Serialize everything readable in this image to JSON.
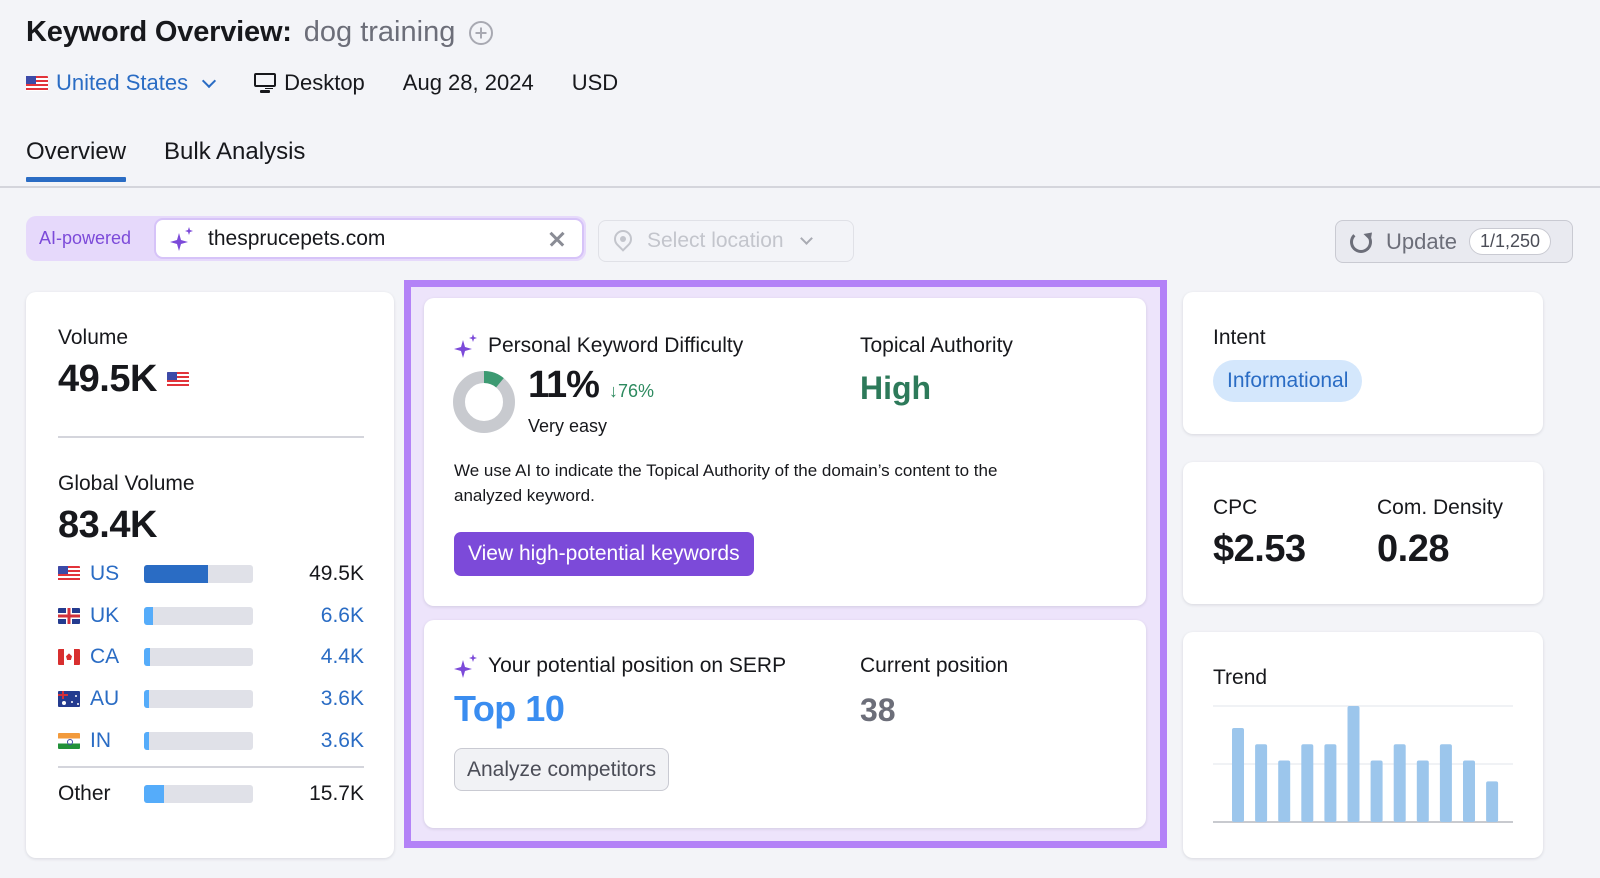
{
  "header": {
    "title": "Keyword Overview:",
    "keyword": "dog training",
    "add_icon": "plus-circle-icon",
    "database": "United States",
    "device": "Desktop",
    "date": "Aug 28, 2024",
    "currency": "USD"
  },
  "tabs": [
    {
      "label": "Overview",
      "active": true
    },
    {
      "label": "Bulk Analysis",
      "active": false
    }
  ],
  "domain_bar": {
    "ai_label": "AI-powered",
    "domain_value": "thesprucepets.com",
    "location_placeholder": "Select location",
    "update_label": "Update",
    "update_count": "1/1,250"
  },
  "volume": {
    "label": "Volume",
    "value": "49.5K",
    "global_label": "Global Volume",
    "global_value": "83.4K",
    "countries": [
      {
        "code": "US",
        "value": "49.5K",
        "share": 0.59,
        "flag": "us"
      },
      {
        "code": "UK",
        "value": "6.6K",
        "share": 0.079,
        "flag": "uk"
      },
      {
        "code": "CA",
        "value": "4.4K",
        "share": 0.053,
        "flag": "ca"
      },
      {
        "code": "AU",
        "value": "3.6K",
        "share": 0.043,
        "flag": "au"
      },
      {
        "code": "IN",
        "value": "3.6K",
        "share": 0.043,
        "flag": "in"
      }
    ],
    "other": {
      "label": "Other",
      "value": "15.7K",
      "share": 0.188
    }
  },
  "keyword_difficulty": {
    "title": "Personal Keyword Difficulty",
    "value": "11%",
    "percent": 11,
    "delta": "↓76%",
    "level": "Very easy",
    "topical_authority_label": "Topical Authority",
    "topical_authority_value": "High",
    "description": "We use AI to indicate the Topical Authority of the domain’s content to the analyzed keyword.",
    "button_label": "View high-potential keywords"
  },
  "serp": {
    "title": "Your potential position on SERP",
    "value": "Top 10",
    "current_label": "Current position",
    "current_value": "38",
    "button_label": "Analyze competitors"
  },
  "intent": {
    "label": "Intent",
    "value": "Informational"
  },
  "cpc": {
    "label": "CPC",
    "value": "$2.53",
    "density_label": "Com. Density",
    "density_value": "0.28"
  },
  "trend": {
    "label": "Trend"
  },
  "colors": {
    "accent_blue": "#2a6cc4",
    "ai_purple": "#7c4ad9",
    "highlight_frame": "#b382f7",
    "positive_green": "#2d7a5a",
    "trend_bar": "#9cc6ec"
  },
  "chart_data": {
    "type": "bar",
    "title": "Trend",
    "categories": [
      "1",
      "2",
      "3",
      "4",
      "5",
      "6",
      "7",
      "8",
      "9",
      "10",
      "11",
      "12"
    ],
    "values": [
      0.81,
      0.67,
      0.53,
      0.67,
      0.67,
      1.0,
      0.53,
      0.67,
      0.53,
      0.67,
      0.53,
      0.35
    ],
    "ylim": [
      0,
      1
    ],
    "grid": true,
    "xlabel": "",
    "ylabel": ""
  }
}
